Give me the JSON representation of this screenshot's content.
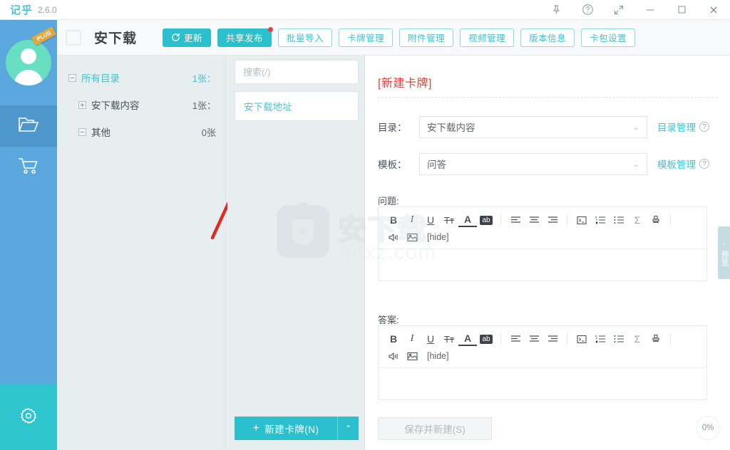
{
  "window": {
    "app_name": "记乎",
    "version": "2.6.0",
    "controls": [
      {
        "name": "pin-icon",
        "label": "固定"
      },
      {
        "name": "help-icon",
        "label": "帮助"
      },
      {
        "name": "expand-icon",
        "label": "全屏"
      },
      {
        "name": "minimize-icon",
        "label": "最小化"
      },
      {
        "name": "maximize-icon",
        "label": "最大化"
      },
      {
        "name": "close-icon",
        "label": "关闭"
      }
    ]
  },
  "rail": {
    "avatar_badge": "PLUS",
    "items": [
      {
        "icon": "folder-icon",
        "label": "卡包",
        "active": true
      },
      {
        "icon": "cart-icon",
        "label": "商店",
        "active": false
      }
    ],
    "settings": {
      "icon": "gear-icon",
      "label": "设置"
    }
  },
  "header": {
    "title": "安下载",
    "buttons": [
      {
        "label": "更新",
        "style": "solid",
        "icon": "refresh-icon",
        "badge": false
      },
      {
        "label": "共享发布",
        "style": "solid",
        "icon": "",
        "badge": true
      },
      {
        "label": "批量导入",
        "style": "ghost",
        "icon": "",
        "badge": false
      },
      {
        "label": "卡牌管理",
        "style": "ghost",
        "icon": "",
        "badge": false
      },
      {
        "label": "附件管理",
        "style": "ghost",
        "icon": "",
        "badge": false
      },
      {
        "label": "视频管理",
        "style": "ghost",
        "icon": "",
        "badge": false
      },
      {
        "label": "版本信息",
        "style": "ghost",
        "icon": "",
        "badge": false
      },
      {
        "label": "卡包设置",
        "style": "ghost",
        "icon": "",
        "badge": false
      }
    ]
  },
  "tree": {
    "rows": [
      {
        "label": "所有目录",
        "count": "1张：",
        "level": 0,
        "toggle": "minus",
        "selected": true
      },
      {
        "label": "安下载内容",
        "count": "1张：",
        "level": 1,
        "toggle": "plus",
        "selected": false
      },
      {
        "label": "其他",
        "count": "0张",
        "level": 1,
        "toggle": "minus",
        "selected": false
      }
    ]
  },
  "list": {
    "search_placeholder": "搜索(/)",
    "search_value": "",
    "cards": [
      {
        "title": "安下载地址"
      }
    ],
    "new_card_label": "新建卡牌(N)",
    "new_card_plus": "+",
    "new_card_caret": "⌃"
  },
  "editor": {
    "title": "[新建卡牌]",
    "fields": [
      {
        "label": "目录：",
        "value": "安下载内容",
        "link": "目录管理",
        "help": "?"
      },
      {
        "label": "模板：",
        "value": "问答",
        "link": "模板管理",
        "help": "?"
      }
    ],
    "sections": [
      {
        "label": "问题:",
        "hide_tag": "[hide]",
        "content": "",
        "tools_row1": [
          {
            "name": "bold-icon",
            "glyph": "B"
          },
          {
            "name": "italic-icon",
            "glyph": "I"
          },
          {
            "name": "underline-icon",
            "glyph": "U"
          },
          {
            "name": "strikethrough-icon",
            "glyph": "Tт"
          },
          {
            "name": "font-color-icon",
            "glyph": "A"
          },
          {
            "name": "highlight-icon",
            "glyph": "ab"
          },
          {
            "name": "align-left-icon",
            "glyph": "≡"
          },
          {
            "name": "align-center-icon",
            "glyph": "≡"
          },
          {
            "name": "align-right-icon",
            "glyph": "≡"
          },
          {
            "name": "code-block-icon",
            "glyph": "▣"
          },
          {
            "name": "ordered-list-icon",
            "glyph": "⒈"
          },
          {
            "name": "bullet-list-icon",
            "glyph": "⁝"
          },
          {
            "name": "formula-icon",
            "glyph": "Σ"
          },
          {
            "name": "clear-format-icon",
            "glyph": "⎚"
          }
        ],
        "tools_row2": [
          {
            "name": "audio-icon",
            "glyph": "◁"
          },
          {
            "name": "image-icon",
            "glyph": "▨"
          }
        ]
      },
      {
        "label": "答案:",
        "hide_tag": "[hide]",
        "content": "",
        "tools_row1": [
          {
            "name": "bold-icon",
            "glyph": "B"
          },
          {
            "name": "italic-icon",
            "glyph": "I"
          },
          {
            "name": "underline-icon",
            "glyph": "U"
          },
          {
            "name": "strikethrough-icon",
            "glyph": "Tт"
          },
          {
            "name": "font-color-icon",
            "glyph": "A"
          },
          {
            "name": "highlight-icon",
            "glyph": "ab"
          },
          {
            "name": "align-left-icon",
            "glyph": "≡"
          },
          {
            "name": "align-center-icon",
            "glyph": "≡"
          },
          {
            "name": "align-right-icon",
            "glyph": "≡"
          },
          {
            "name": "code-block-icon",
            "glyph": "▣"
          },
          {
            "name": "ordered-list-icon",
            "glyph": "⒈"
          },
          {
            "name": "bullet-list-icon",
            "glyph": "⁝"
          },
          {
            "name": "formula-icon",
            "glyph": "Σ"
          },
          {
            "name": "clear-format-icon",
            "glyph": "⎚"
          }
        ],
        "tools_row2": [
          {
            "name": "audio-icon",
            "glyph": "◁"
          },
          {
            "name": "image-icon",
            "glyph": "▨"
          }
        ]
      }
    ],
    "save_label": "保存并新建(S)",
    "progress": "0%",
    "preview_label": "预览",
    "preview_caret": "‹"
  },
  "watermark": {
    "text": "安下载",
    "sub": "anxz.com",
    "logo_char": "安"
  },
  "colors": {
    "accent": "#2ac0ce",
    "rail": "#5aa8dd",
    "panel": "#e7eef0",
    "title_red": "#e8413c",
    "badge_red": "#e8413c"
  }
}
